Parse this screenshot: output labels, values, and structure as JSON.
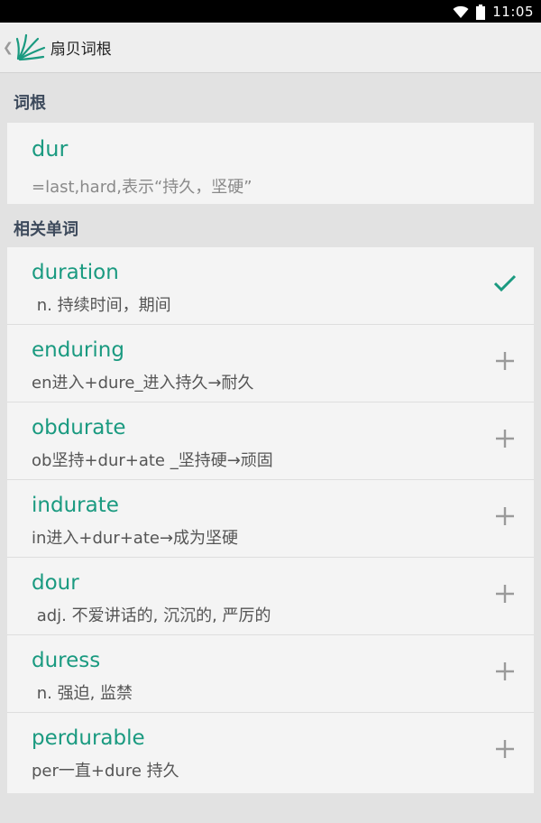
{
  "status_bar": {
    "time": "11:05"
  },
  "action_bar": {
    "title": "扇贝词根"
  },
  "root_section": {
    "header": "词根",
    "root": "dur",
    "description": "=last,hard,表示“持久，坚硬”"
  },
  "related_section": {
    "header": "相关单词",
    "words": [
      {
        "word": "duration",
        "meaning": " n. 持续时间，期间",
        "action_icon": "check-icon",
        "added": true
      },
      {
        "word": "enduring",
        "meaning": "en进入+dure_进入持久→耐久",
        "action_icon": "plus-icon",
        "added": false
      },
      {
        "word": "obdurate",
        "meaning": "ob坚持+dur+ate _坚持硬→顽固",
        "action_icon": "plus-icon",
        "added": false
      },
      {
        "word": "indurate",
        "meaning": "in进入+dur+ate→成为坚硬",
        "action_icon": "plus-icon",
        "added": false
      },
      {
        "word": "dour",
        "meaning": " adj. 不爱讲话的, 沉沉的, 严厉的",
        "action_icon": "plus-icon",
        "added": false
      },
      {
        "word": "duress",
        "meaning": " n. 强迫, 监禁",
        "action_icon": "plus-icon",
        "added": false
      },
      {
        "word": "perdurable",
        "meaning": "per一直+dure 持久",
        "action_icon": "plus-icon",
        "added": false
      }
    ]
  },
  "colors": {
    "accent": "#1a9a80",
    "icon_grey": "#9a9a9a",
    "card_bg": "#f4f4f4",
    "page_bg": "#e2e2e2"
  }
}
